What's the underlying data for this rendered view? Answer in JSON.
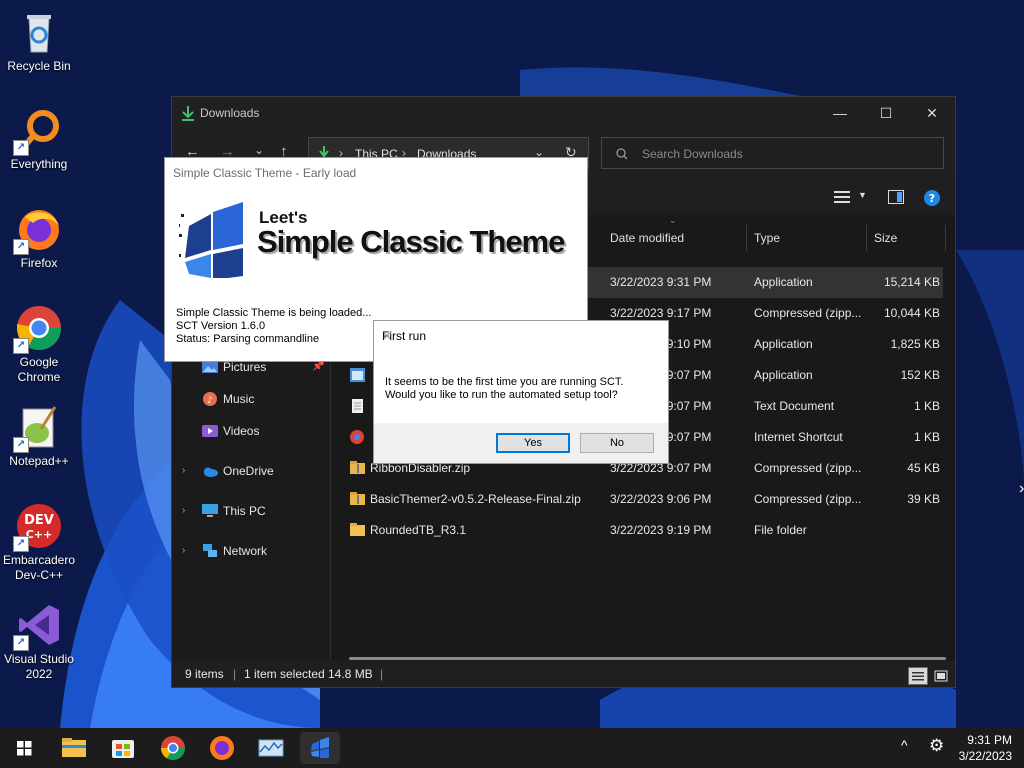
{
  "desktop": {
    "icons": [
      {
        "label": "Recycle Bin",
        "icon": "recycle-bin-icon"
      },
      {
        "label": "Everything",
        "icon": "everything-icon"
      },
      {
        "label": "Firefox",
        "icon": "firefox-icon"
      },
      {
        "label": "Google Chrome",
        "icon": "chrome-icon"
      },
      {
        "label": "Notepad++",
        "icon": "notepadpp-icon"
      },
      {
        "label": "Embarcadero Dev-C++",
        "icon": "devcpp-icon"
      },
      {
        "label": "Visual Studio 2022",
        "icon": "visual-studio-icon"
      }
    ]
  },
  "explorer": {
    "title": "Downloads",
    "address": {
      "segments": [
        "This PC",
        "Downloads"
      ]
    },
    "search_placeholder": "Search Downloads",
    "columns": {
      "date": "Date modified",
      "type": "Type",
      "size": "Size"
    },
    "nav": [
      {
        "label": "Pictures",
        "icon": "pictures-icon"
      },
      {
        "label": "Music",
        "icon": "music-icon"
      },
      {
        "label": "Videos",
        "icon": "videos-icon"
      },
      {
        "label": "OneDrive",
        "icon": "onedrive-icon"
      },
      {
        "label": "This PC",
        "icon": "this-pc-icon"
      },
      {
        "label": "Network",
        "icon": "network-icon"
      }
    ],
    "files": [
      {
        "name": "",
        "date": "3/22/2023 9:31 PM",
        "type": "Application",
        "size": "15,214 KB",
        "selected": true
      },
      {
        "name": "",
        "date": "3/22/2023 9:17 PM",
        "type": "Compressed (zipp...",
        "size": "10,044 KB"
      },
      {
        "name": "",
        "date": "3/22/2023 9:10 PM",
        "type": "Application",
        "size": "1,825 KB"
      },
      {
        "name": "",
        "date": "3/22/2023 9:07 PM",
        "type": "Application",
        "size": "152 KB"
      },
      {
        "name": "",
        "date": "3/22/2023 9:07 PM",
        "type": "Text Document",
        "size": "1 KB"
      },
      {
        "name": "",
        "date": "3/22/2023 9:07 PM",
        "type": "Internet Shortcut",
        "size": "1 KB"
      },
      {
        "name": "RibbonDisabler.zip",
        "date": "3/22/2023 9:07 PM",
        "type": "Compressed (zipp...",
        "size": "45 KB"
      },
      {
        "name": "BasicThemer2-v0.5.2-Release-Final.zip",
        "date": "3/22/2023 9:06 PM",
        "type": "Compressed (zipp...",
        "size": "39 KB"
      },
      {
        "name": "RoundedTB_R3.1",
        "date": "3/22/2023 9:19 PM",
        "type": "File folder",
        "size": ""
      }
    ],
    "status": {
      "items": "9 items",
      "selected": "1 item selected",
      "size": "14.8 MB"
    }
  },
  "splash": {
    "title": "Simple Classic Theme - Early load",
    "logo_small": "Leet's",
    "logo_big": "Simple Classic Theme",
    "line1": "Simple Classic Theme is being loaded...",
    "line2": "SCT Version 1.6.0",
    "line3": "Status: Parsing commandline"
  },
  "dialog": {
    "title": "First run",
    "line1": "It seems to be the first time you are running SCT.",
    "line2": "Would you like to run the automated setup tool?",
    "yes": "Yes",
    "no": "No"
  },
  "taskbar": {
    "apps": [
      "start-icon",
      "file-explorer-icon",
      "store-icon",
      "chrome-icon",
      "firefox-icon",
      "resource-monitor-icon",
      "sct-icon"
    ],
    "time": "9:31 PM",
    "date": "3/22/2023"
  },
  "colors": {
    "accent": "#0078d7",
    "explorer_bg": "#191919",
    "selected_row": "#333333"
  }
}
